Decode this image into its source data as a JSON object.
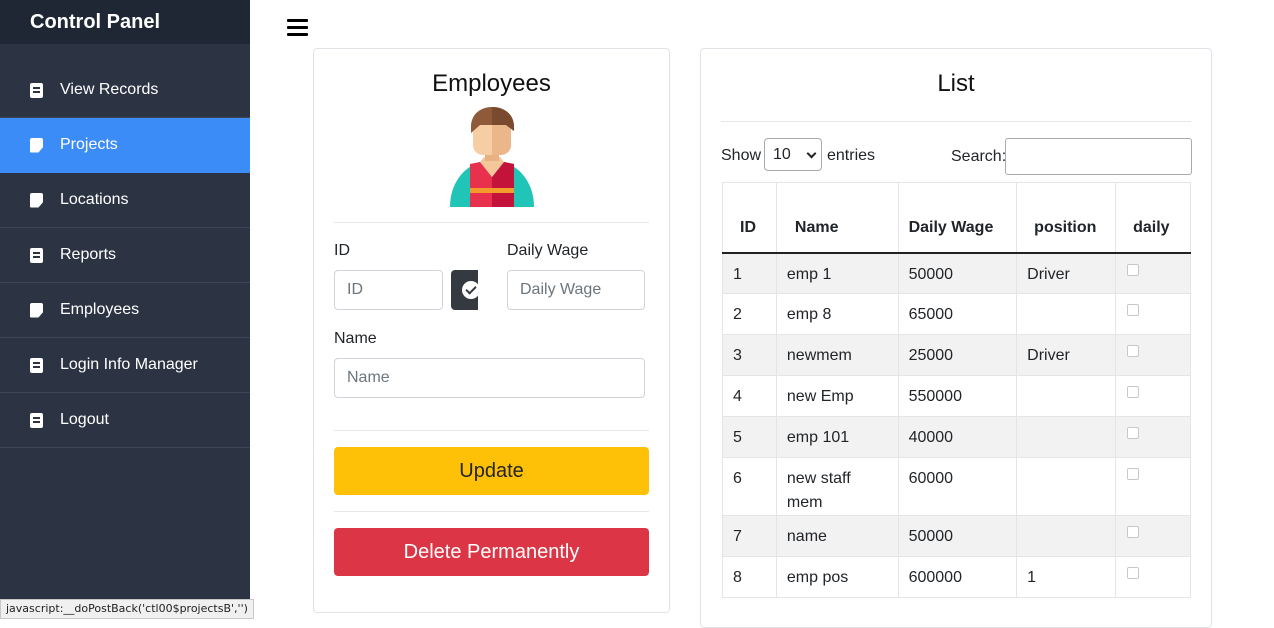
{
  "sidebar": {
    "title": "Control Panel",
    "items": [
      {
        "label": "View Records",
        "icon": "document-icon"
      },
      {
        "label": "Projects",
        "icon": "note-icon",
        "active": true
      },
      {
        "label": "Locations",
        "icon": "note-icon"
      },
      {
        "label": "Reports",
        "icon": "document-icon"
      },
      {
        "label": "Employees",
        "icon": "note-icon"
      },
      {
        "label": "Login Info Manager",
        "icon": "document-icon"
      },
      {
        "label": "Logout",
        "icon": "document-icon"
      }
    ]
  },
  "status_bar": {
    "text": "javascript:__doPostBack('ctl00$projectsB','')"
  },
  "form": {
    "title": "Employees",
    "id_label": "ID",
    "id_placeholder": "ID",
    "wage_label": "Daily Wage",
    "wage_placeholder": "Daily Wage",
    "name_label": "Name",
    "name_placeholder": "Name",
    "update_label": "Update",
    "delete_label": "Delete Permanently"
  },
  "list": {
    "title": "List",
    "show_label": "Show",
    "entries_value": "10",
    "entries_label": "entries",
    "search_label": "Search:",
    "columns": [
      "ID",
      "Name",
      "Daily Wage",
      "position",
      "daily"
    ],
    "rows": [
      {
        "id": "1",
        "name": "emp 1",
        "wage": "50000",
        "position": "Driver",
        "daily": false
      },
      {
        "id": "2",
        "name": "emp 8",
        "wage": "65000",
        "position": "",
        "daily": false
      },
      {
        "id": "3",
        "name": "newmem",
        "wage": "25000",
        "position": "Driver",
        "daily": false
      },
      {
        "id": "4",
        "name": "new Emp",
        "wage": "550000",
        "position": "",
        "daily": false
      },
      {
        "id": "5",
        "name": "emp 101",
        "wage": "40000",
        "position": "",
        "daily": false
      },
      {
        "id": "6",
        "name": "new staff mem",
        "wage": "60000",
        "position": "",
        "daily": false
      },
      {
        "id": "7",
        "name": "name",
        "wage": "50000",
        "position": "",
        "daily": false
      },
      {
        "id": "8",
        "name": "emp pos",
        "wage": "600000",
        "position": "1",
        "daily": false
      }
    ]
  },
  "colors": {
    "sidebar_bg": "#2c3444",
    "sidebar_header_bg": "#202734",
    "active_item": "#3b8cf6",
    "update_button": "#ffc107",
    "delete_button": "#dc3545"
  }
}
